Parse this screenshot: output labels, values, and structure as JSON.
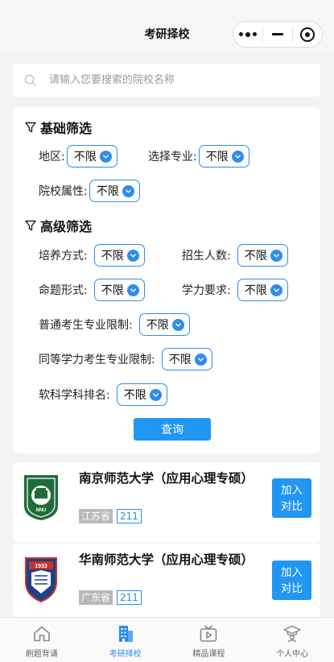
{
  "header": {
    "title": "考研择校"
  },
  "search": {
    "placeholder": "请输入您要搜索的院校名称"
  },
  "basic_filter": {
    "title": "基础筛选",
    "fields": [
      {
        "label": "地区:",
        "value": "不限"
      },
      {
        "label": "选择专业:",
        "value": "不限"
      },
      {
        "label": "院校属性:",
        "value": "不限"
      }
    ]
  },
  "advanced_filter": {
    "title": "高级筛选",
    "fields": [
      {
        "label": "培养方式:",
        "value": "不限"
      },
      {
        "label": "招生人数:",
        "value": "不限"
      },
      {
        "label": "命题形式:",
        "value": "不限"
      },
      {
        "label": "学力要求:",
        "value": "不限"
      },
      {
        "label": "普通考生专业限制:",
        "value": "不限"
      },
      {
        "label": "同等学力考生专业限制:",
        "value": "不限"
      },
      {
        "label": "软科学科排名:",
        "value": "不限"
      }
    ]
  },
  "query_button": "查询",
  "schools": [
    {
      "name": "南京师范大学（应用心理专硕）",
      "province": "江苏省",
      "tag": "211",
      "button": "加入\n对比",
      "logo_text": "NNU"
    },
    {
      "name": "华南师范大学（应用心理专硕）",
      "province": "广东省",
      "tag": "211",
      "button": "加入\n对比",
      "logo_text": "1933"
    }
  ],
  "tabbar": [
    {
      "label": "刷题背诵",
      "icon": "home-icon",
      "active": false
    },
    {
      "label": "考研择校",
      "icon": "building-icon",
      "active": true
    },
    {
      "label": "精品课程",
      "icon": "video-play-icon",
      "active": false
    },
    {
      "label": "个人中心",
      "icon": "graduation-cap-icon",
      "active": false
    }
  ],
  "colors": {
    "accent": "#2196f3",
    "border_blue": "#2d8cf0",
    "background": "#f2f3f5",
    "province_tag": "#b9b9b9"
  }
}
